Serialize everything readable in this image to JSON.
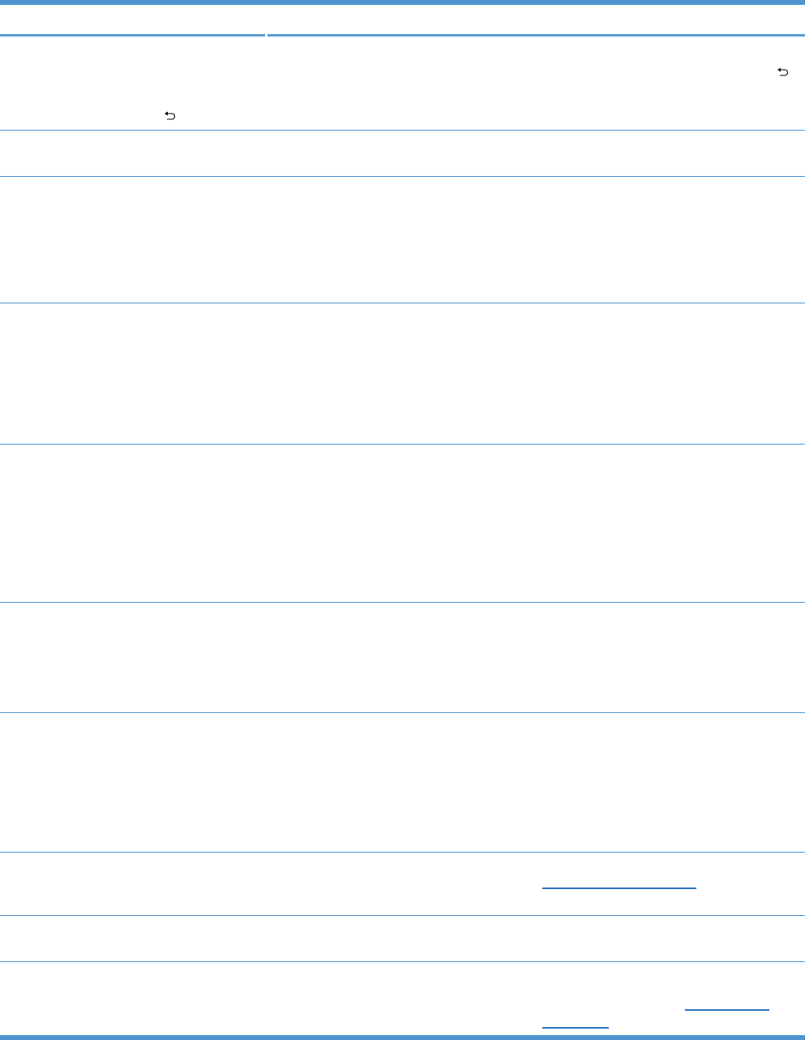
{
  "document": {
    "rows": [
      {
        "id": "row-1",
        "icons": [
          "back-arrow-icon",
          "back-arrow-icon"
        ]
      },
      {
        "id": "row-2"
      },
      {
        "id": "row-3"
      },
      {
        "id": "row-4"
      },
      {
        "id": "row-5"
      },
      {
        "id": "row-6"
      },
      {
        "id": "row-7"
      },
      {
        "id": "row-8",
        "links": [
          "cross-reference-link"
        ]
      },
      {
        "id": "row-9"
      },
      {
        "id": "row-10",
        "links": [
          "cross-reference-link",
          "cross-reference-link-continued"
        ]
      }
    ],
    "colors": {
      "rule": "#4f93cf",
      "header": "#5b9bd5",
      "link": "#2b73c2"
    }
  }
}
